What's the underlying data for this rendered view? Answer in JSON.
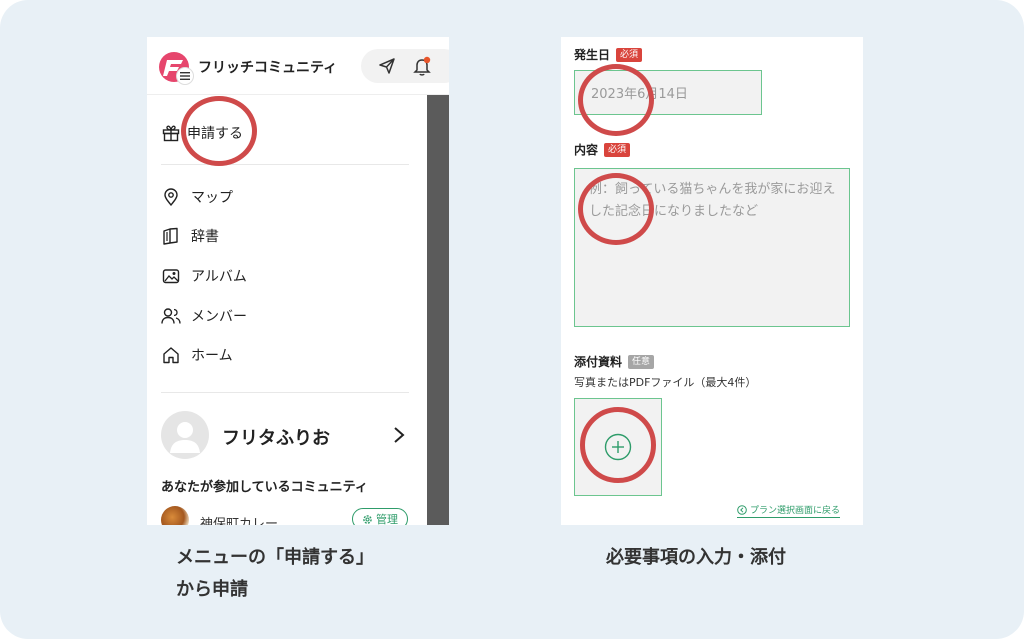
{
  "left_panel": {
    "community_name": "フリッチコミュニティ",
    "menu": [
      {
        "label": "申請する",
        "icon": "gift-icon"
      },
      {
        "label": "マップ",
        "icon": "map-pin-icon"
      },
      {
        "label": "辞書",
        "icon": "book-icon"
      },
      {
        "label": "アルバム",
        "icon": "album-icon"
      },
      {
        "label": "メンバー",
        "icon": "members-icon"
      },
      {
        "label": "ホーム",
        "icon": "home-icon"
      }
    ],
    "profile": {
      "name": "フリタふりお"
    },
    "joined_title": "あなたが参加しているコミュニティ",
    "joined_community": {
      "name": "神保町カレー",
      "manage_label": "管理"
    }
  },
  "right_panel": {
    "date": {
      "label": "発生日",
      "badge": "必須",
      "value": "2023年6月14日"
    },
    "content": {
      "label": "内容",
      "badge": "必須",
      "placeholder": "例：飼っている猫ちゃんを我が家にお迎えした記念日になりましたなど"
    },
    "attachment": {
      "label": "添付資料",
      "badge": "任意",
      "note": "写真またはPDFファイル（最大4件）"
    },
    "back_link": "プラン選択画面に戻る"
  },
  "captions": {
    "left_line1": "メニューの「申請する」",
    "left_line2": "から申請",
    "right": "必要事項の入力・添付"
  },
  "colors": {
    "background": "#e8f0f6",
    "highlight": "#cf4a4a",
    "required": "#d9443c",
    "accent_green": "#2e9c6a",
    "field_border": "#6cc58f"
  }
}
